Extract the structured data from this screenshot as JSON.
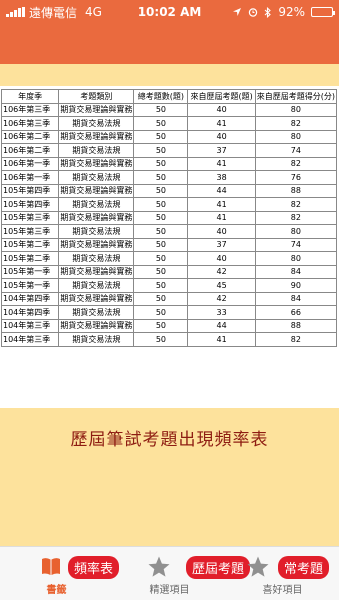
{
  "status": {
    "carrier": "遠傳電信",
    "network": "4G",
    "time": "10:02 AM",
    "battery_pct": 92,
    "battery_label": "92%"
  },
  "table": {
    "headers": [
      "年度季",
      "考題類別",
      "總考題數(題)",
      "來自歷屆考題(題)",
      "來自歷屆考題得分(分)"
    ],
    "rows": [
      [
        "106年第三季",
        "期貨交易理論與實務",
        "50",
        "40",
        "80"
      ],
      [
        "106年第三季",
        "期貨交易法規",
        "50",
        "41",
        "82"
      ],
      [
        "106年第二季",
        "期貨交易理論與實務",
        "50",
        "40",
        "80"
      ],
      [
        "106年第二季",
        "期貨交易法規",
        "50",
        "37",
        "74"
      ],
      [
        "106年第一季",
        "期貨交易理論與實務",
        "50",
        "41",
        "82"
      ],
      [
        "106年第一季",
        "期貨交易法規",
        "50",
        "38",
        "76"
      ],
      [
        "105年第四季",
        "期貨交易理論與實務",
        "50",
        "44",
        "88"
      ],
      [
        "105年第四季",
        "期貨交易法規",
        "50",
        "41",
        "82"
      ],
      [
        "105年第三季",
        "期貨交易理論與實務",
        "50",
        "41",
        "82"
      ],
      [
        "105年第三季",
        "期貨交易法規",
        "50",
        "40",
        "80"
      ],
      [
        "105年第二季",
        "期貨交易理論與實務",
        "50",
        "37",
        "74"
      ],
      [
        "105年第二季",
        "期貨交易法規",
        "50",
        "40",
        "80"
      ],
      [
        "105年第一季",
        "期貨交易理論與實務",
        "50",
        "42",
        "84"
      ],
      [
        "105年第一季",
        "期貨交易法規",
        "50",
        "45",
        "90"
      ],
      [
        "104年第四季",
        "期貨交易理論與實務",
        "50",
        "42",
        "84"
      ],
      [
        "104年第四季",
        "期貨交易法規",
        "50",
        "33",
        "66"
      ],
      [
        "104年第三季",
        "期貨交易理論與實務",
        "50",
        "44",
        "88"
      ],
      [
        "104年第三季",
        "期貨交易法規",
        "50",
        "41",
        "82"
      ]
    ]
  },
  "caption": "歷屆筆試考題出現頻率表",
  "tabs": [
    {
      "label": "書籤",
      "badge": "頻率表",
      "icon": "book-icon",
      "active": true
    },
    {
      "label": "精選項目",
      "badge": "歷屆考題",
      "icon": "star-icon",
      "active": false
    },
    {
      "label": "喜好項目",
      "badge": "常考題",
      "icon": "star-icon",
      "active": false
    }
  ],
  "colors": {
    "accent": "#ea6a3e",
    "content_bg": "#fde29c",
    "caption": "#8e1d12",
    "badge": "#e11e2a",
    "tab_active": "#e8612f"
  }
}
